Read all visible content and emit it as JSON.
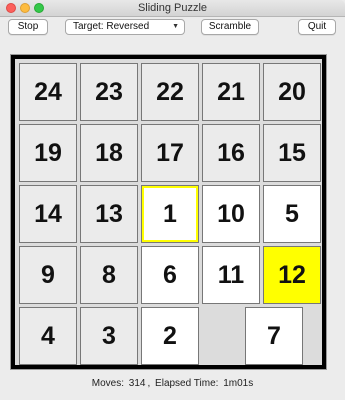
{
  "window": {
    "title": "Sliding Puzzle"
  },
  "toolbar": {
    "stop_label": "Stop",
    "target_label": "Target: Reversed",
    "scramble_label": "Scramble",
    "quit_label": "Quit"
  },
  "board": {
    "rows": [
      [
        "24",
        "23",
        "22",
        "21",
        "20"
      ],
      [
        "19",
        "18",
        "17",
        "16",
        "15"
      ],
      [
        "14",
        "13",
        "1",
        "10",
        "5"
      ],
      [
        "9",
        "8",
        "6",
        "11",
        "12"
      ],
      [
        "4",
        "3",
        "2",
        "",
        "7"
      ]
    ]
  },
  "status": {
    "moves_label": "Moves:",
    "moves": "314",
    "elapsed_label": "Elapsed Time:",
    "elapsed": "1m01s"
  },
  "colors": {
    "highlight": "#ffff00",
    "tile_gray": "#ebebeb",
    "tile_white": "#ffffff",
    "frame": "#000000"
  }
}
